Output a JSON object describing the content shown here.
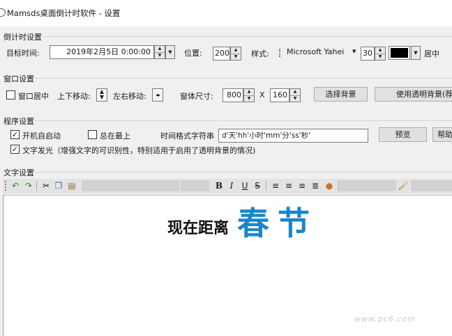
{
  "window": {
    "title": "Mamsds桌面倒计时软件 - 设置"
  },
  "countdown_settings": {
    "section_label": "倒计时设置",
    "target_label": "目标时间:",
    "target_value": "2019年2月5日 0:00:00",
    "position_label": "位置:",
    "position_value": "200",
    "style_label": "样式:",
    "font_value": "Microsoft Yahei",
    "font_size_value": "30",
    "color_value": "#000000",
    "align_value": "居中"
  },
  "window_settings": {
    "section_label": "窗口设置",
    "center_label": "窗口居中",
    "center_checked": false,
    "move_vertical_label": "上下移动:",
    "move_horizontal_label": "左右移动:",
    "size_label": "窗体尺寸:",
    "width_value": "800",
    "x_sep": "X",
    "height_value": "160",
    "choose_bg_label": "选择背景",
    "transparent_bg_label": "使用透明背景(荐)"
  },
  "program_settings": {
    "section_label": "程序设置",
    "autostart_label": "开机自启动",
    "autostart_checked": true,
    "always_top_label": "总在最上",
    "always_top_checked": false,
    "time_format_label": "时间格式字符串",
    "time_format_value": "d'天'hh'小时'mm'分'ss'秒'",
    "preview_label": "预览",
    "help_label": "帮助",
    "glow_label": "文字发光（增强文字的可识别性，特别适用于启用了透明背景的情况)",
    "glow_checked": true
  },
  "text_settings": {
    "section_label": "文字设置",
    "editor_plain_text": "现在距离",
    "editor_highlight_text": "春节",
    "highlight_color": "#1a86c8"
  },
  "watermark": "www.pc6.com"
}
